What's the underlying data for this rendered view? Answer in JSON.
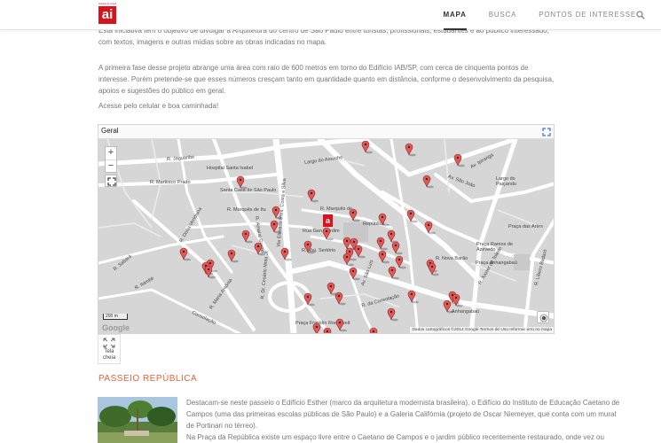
{
  "header": {
    "logo_top": "Instituto de Arquitetos",
    "logo_mark": "ai",
    "nav": [
      {
        "label": "MAPA",
        "active": true
      },
      {
        "label": "BUSCA",
        "active": false
      },
      {
        "label": "PONTOS DE INTERESSE",
        "active": false
      }
    ],
    "search_icon": "search-icon"
  },
  "intro": {
    "p1": "Esta iniciativa tem o objetivo de divulgar a Arquitetura do centro de São Paulo entre turistas, profissionais, estudantes e ao público interessado, com textos, imagens e outras mídias sobre as obras indicadas no mapa.",
    "p2": "A primeira fase desse projeto abrange uma área com raio de 600 metros em torno do Edifício IAB/SP, com cerca de cinquenta pontos de interesse. Porém pretende-se que esses números cresçam tanto em quantidade quanto em distância, conforme o desenvolvimento da pesquisa, apoios e sugestões do público em geral.",
    "p3": "Acesse pelo celular e boa caminhada!"
  },
  "map": {
    "title": "Geral",
    "zoom_in": "+",
    "zoom_out": "−",
    "scale": "200 m",
    "google": "Google",
    "attribution": "Dados cartográficos ©2014 Google   Termos de Uso   Informar erro no mapa",
    "labels": [
      {
        "text": "R. Jaguaribe"
      },
      {
        "text": "Hospital Santa Isabel"
      },
      {
        "text": "Santa Casa de São Paulo"
      },
      {
        "text": "R. Martinico Prado"
      },
      {
        "text": "Largo do Arouche"
      },
      {
        "text": "R. Marquês de Itu"
      },
      {
        "text": "R. Marquês de"
      },
      {
        "text": "Rua Gen. Jardim"
      },
      {
        "text": "R. Maj. Sertório"
      },
      {
        "text": "República"
      },
      {
        "text": "Av. Ipiranga"
      },
      {
        "text": "Av. São João"
      },
      {
        "text": "Largo do Paiçandu"
      },
      {
        "text": "Praça das Artes"
      },
      {
        "text": "Praça Ramos de Azevedo"
      },
      {
        "text": "Praça Anhangabaú"
      },
      {
        "text": "Anhangabaú"
      },
      {
        "text": "Consolação"
      },
      {
        "text": "R. Amaral Gurgel"
      },
      {
        "text": "R. Sabará"
      },
      {
        "text": "R. Itambé"
      },
      {
        "text": "R. Dona Veridiana"
      },
      {
        "text": "R. Dr. Cesário Mota Jr."
      },
      {
        "text": "Via Elevado Pres. Costa e Silva"
      },
      {
        "text": "Av. São Luís"
      },
      {
        "text": "R. da Consolação"
      },
      {
        "text": "R. Líbero Badaró"
      },
      {
        "text": "R. Xavier de Toledo"
      },
      {
        "text": "R. Nova Barão"
      },
      {
        "text": "R. Maria Antônia"
      },
      {
        "text": "Praça Franklin Roosevelt"
      }
    ]
  },
  "tela_cheia": {
    "label": "Tela cheia"
  },
  "section": {
    "title": "PASSEIO REPÚBLICA",
    "text": "Destacam-se neste passeio o Edifício Esther (marco da arquitetura modernista brasileira), o Edifício do Instituto de Educação Caetano de Campos (uma das primeiras escolas públicas de São Paulo) e a Galeria Califórnia (projeto de Oscar Niemeyer, que conta com um mural de Portinari no térreo).",
    "text2": "Na Praça da República existe um espaço livre entre o Caetano de Campos e o jardim público recentemente restaurado, onde vez ou outra"
  },
  "colors": {
    "accent": "#e8633a",
    "pin": "#e05a5a",
    "logo": "#d7141c"
  }
}
